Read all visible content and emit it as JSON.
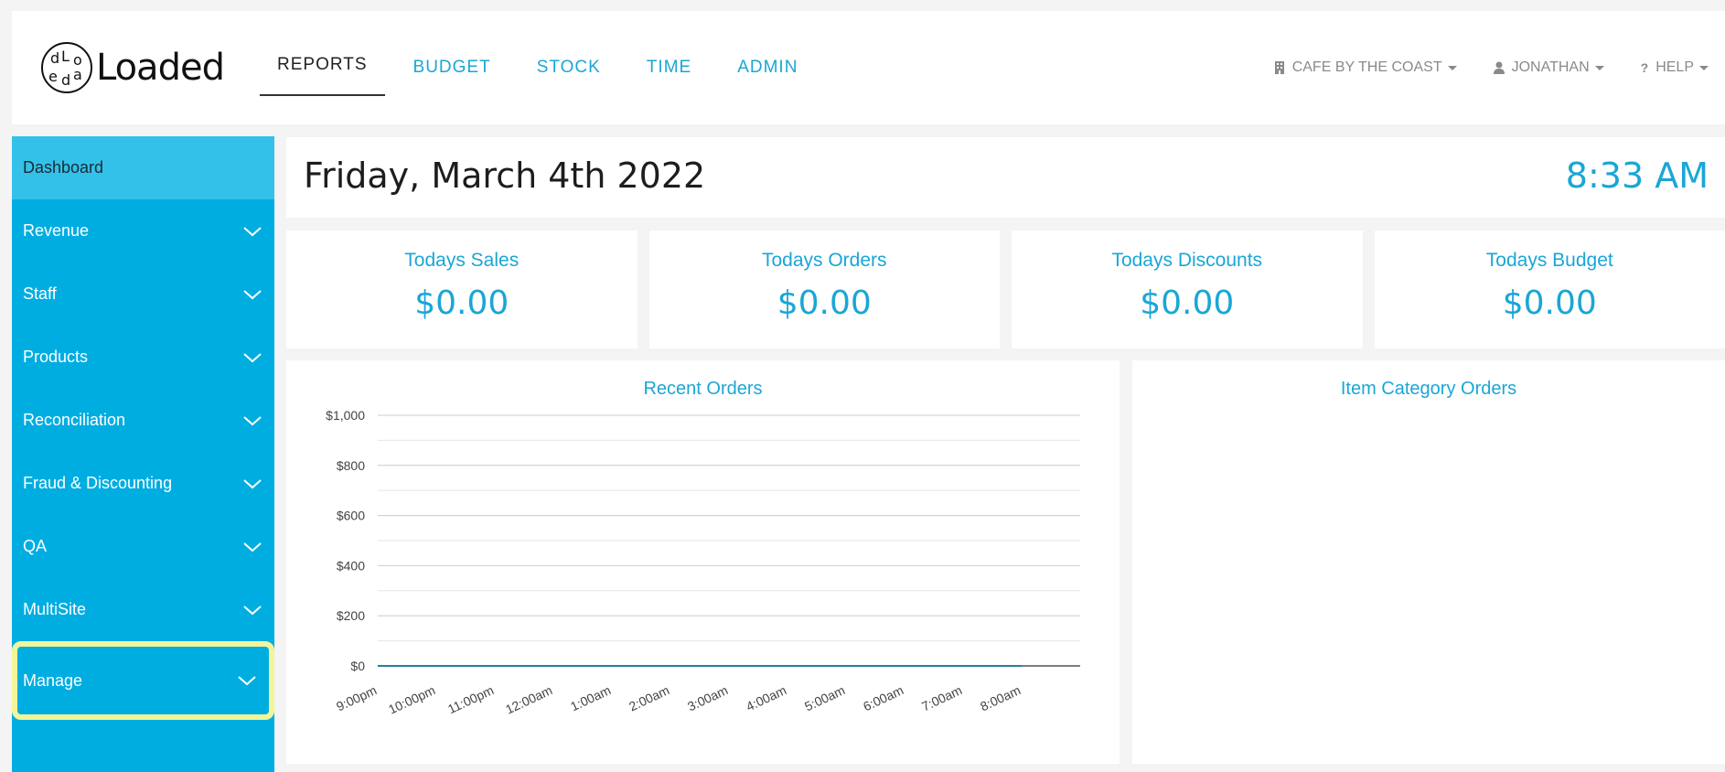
{
  "brand": {
    "logo_text": "Loaded",
    "logo_mark_letters": [
      "d",
      "L",
      "o",
      "e",
      "d",
      "a"
    ]
  },
  "nav": {
    "items": [
      {
        "label": "REPORTS",
        "active": true
      },
      {
        "label": "BUDGET",
        "active": false
      },
      {
        "label": "STOCK",
        "active": false
      },
      {
        "label": "TIME",
        "active": false
      },
      {
        "label": "ADMIN",
        "active": false
      }
    ]
  },
  "header_right": {
    "venue": {
      "label": "CAFE BY THE COAST",
      "icon": "building-icon"
    },
    "user": {
      "label": "JONATHAN",
      "icon": "user-icon"
    },
    "help": {
      "label": "HELP",
      "icon": "question-icon"
    }
  },
  "sidebar": {
    "items": [
      {
        "label": "Dashboard"
      },
      {
        "label": "Revenue"
      },
      {
        "label": "Staff"
      },
      {
        "label": "Products"
      },
      {
        "label": "Reconciliation"
      },
      {
        "label": "Fraud & Discounting"
      },
      {
        "label": "QA"
      },
      {
        "label": "MultiSite"
      },
      {
        "label": "Manage"
      }
    ]
  },
  "datebar": {
    "date": "Friday, March 4th 2022",
    "time": "8:33 AM"
  },
  "stats": [
    {
      "label": "Todays Sales",
      "value": "$0.00"
    },
    {
      "label": "Todays Orders",
      "value": "$0.00"
    },
    {
      "label": "Todays Discounts",
      "value": "$0.00"
    },
    {
      "label": "Todays Budget",
      "value": "$0.00"
    }
  ],
  "panels": {
    "recent_orders_title": "Recent Orders",
    "item_category_title": "Item Category Orders"
  },
  "colors": {
    "accent": "#1aa6d6",
    "sidebar": "#00ade1",
    "sidebar_active": "#33c1ea",
    "highlight": "#f3f59a"
  },
  "chart_data": {
    "type": "line",
    "title": "Recent Orders",
    "x": [
      "9:00pm",
      "10:00pm",
      "11:00pm",
      "12:00am",
      "1:00am",
      "2:00am",
      "3:00am",
      "4:00am",
      "5:00am",
      "6:00am",
      "7:00am",
      "8:00am"
    ],
    "series": [
      {
        "values": [
          0,
          0,
          0,
          0,
          0,
          0,
          0,
          0,
          0,
          0,
          0,
          0
        ]
      }
    ],
    "y_ticks": [
      "$0",
      "$200",
      "$400",
      "$600",
      "$800",
      "$1,000"
    ],
    "ylim": [
      0,
      1000
    ],
    "grid": true
  }
}
